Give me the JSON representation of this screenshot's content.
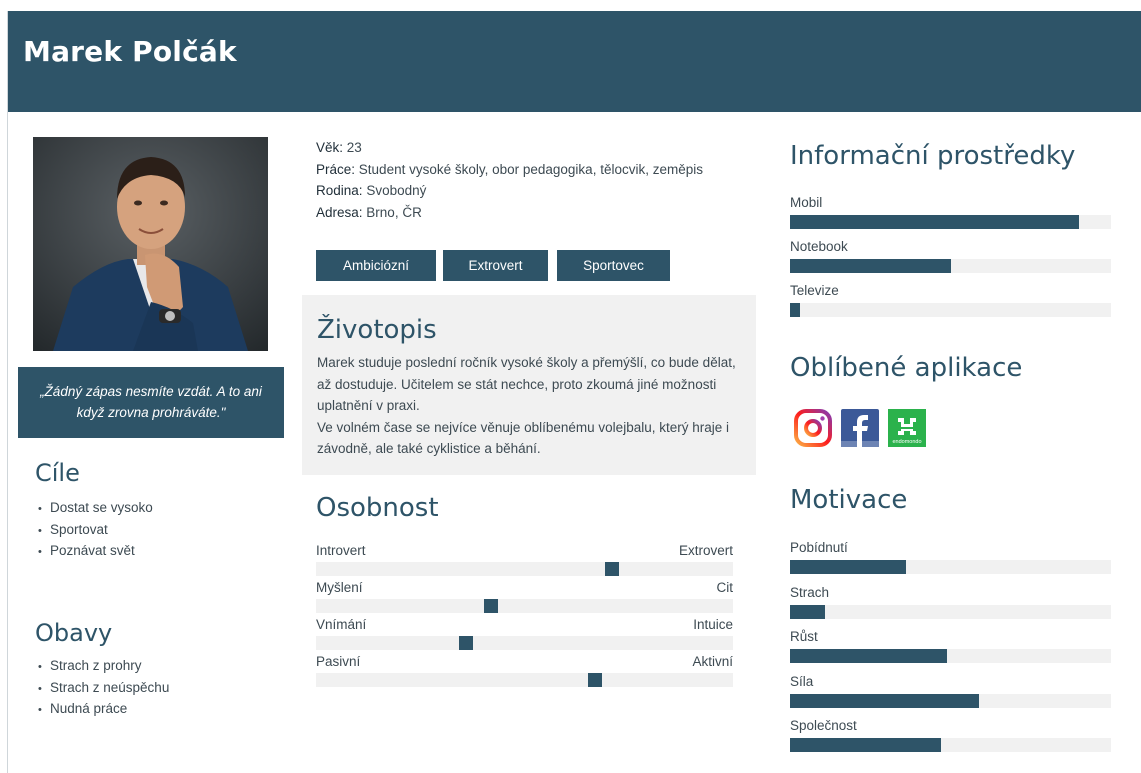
{
  "persona": {
    "name": "Marek Polčák",
    "quote": "„Žádný zápas nesmíte vzdát. A to ani když zrovna prohráváte.\""
  },
  "info": {
    "age_label": "Věk:",
    "age_value": "23",
    "work_label": "Práce:",
    "work_value": "Student vysoké školy, obor pedagogika, tělocvik, zeměpis",
    "family_label": "Rodina:",
    "family_value": "Svobodný",
    "address_label": "Adresa:",
    "address_value": "Brno, ČR"
  },
  "tags": [
    "Ambiciózní",
    "Extrovert",
    "Sportovec"
  ],
  "bio": {
    "title": "Životopis",
    "text": "Marek studuje poslední ročník vysoké školy a přemýšlí, co bude dělat, až dostuduje. Učitelem se stát nechce, proto zkoumá jiné možnosti uplatnění v praxi.\nVe volném čase se nejvíce věnuje oblíbenému volejbalu, který hraje i závodně, ale také cyklistice a běhání."
  },
  "goals": {
    "title": "Cíle",
    "items": [
      "Dostat se vysoko",
      "Sportovat",
      "Poznávat svět"
    ]
  },
  "fears": {
    "title": "Obavy",
    "items": [
      "Strach z prohry",
      "Strach z neúspěchu",
      "Nudná práce"
    ]
  },
  "personality": {
    "title": "Osobnost",
    "scales": [
      {
        "left": "Introvert",
        "right": "Extrovert",
        "value": 0.71
      },
      {
        "left": "Myšlení",
        "right": "Cit",
        "value": 0.42
      },
      {
        "left": "Vnímání",
        "right": "Intuice",
        "value": 0.36
      },
      {
        "left": "Pasivní",
        "right": "Aktivní",
        "value": 0.67
      }
    ]
  },
  "media": {
    "title": "Informační prostředky",
    "items": [
      {
        "label": "Mobil",
        "value": 0.9
      },
      {
        "label": "Notebook",
        "value": 0.5
      },
      {
        "label": "Televize",
        "value": 0.03
      }
    ]
  },
  "apps": {
    "title": "Oblíbené aplikace",
    "icons": [
      "instagram-icon",
      "facebook-icon",
      "endomondo-icon"
    ],
    "endomondo_text": "endomondo"
  },
  "motivation": {
    "title": "Motivace",
    "items": [
      {
        "label": "Pobídnutí",
        "value": 0.36
      },
      {
        "label": "Strach",
        "value": 0.11
      },
      {
        "label": "Růst",
        "value": 0.49
      },
      {
        "label": "Síla",
        "value": 0.59
      },
      {
        "label": "Společnost",
        "value": 0.47
      }
    ]
  },
  "colors": {
    "accent": "#2e5468",
    "track": "#f1f1f1",
    "text": "#3d4a52"
  }
}
